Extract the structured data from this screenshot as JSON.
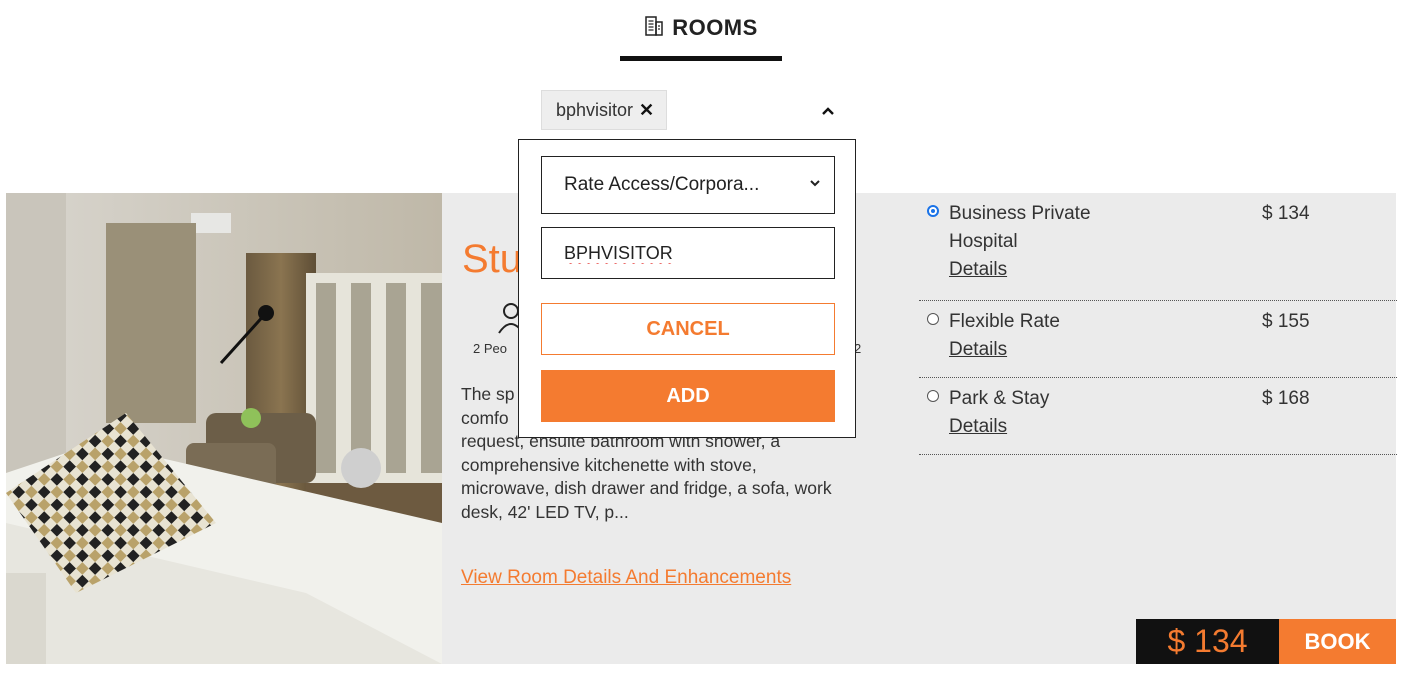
{
  "header": {
    "title": "ROOMS",
    "icon": "building-icon"
  },
  "promo": {
    "chip_label": "bphvisitor",
    "remove_glyph": "✕"
  },
  "popup": {
    "select_value": "Rate Access/Corpora...",
    "input_value": "BPHVISITOR",
    "cancel_label": "CANCEL",
    "add_label": "ADD"
  },
  "room": {
    "title_visible": "Stu",
    "people_visible": "2 Peo",
    "size_visible": "2",
    "description": "The sp comfo request, ensuite bathroom with shower, a comprehensive kitchenette with stove, microwave, dish drawer and fridge, a sofa, work desk, 42' LED TV, p...",
    "description_lines": [
      "The sp",
      "comfo",
      "request, ensuite bathroom with shower, a",
      "comprehensive kitchenette with stove,",
      "microwave, dish drawer and fridge, a sofa, work",
      "desk, 42' LED TV, p..."
    ],
    "view_link": "View Room Details And Enhancements"
  },
  "rates": [
    {
      "name": "Business Private Hospital",
      "price": "$ 134",
      "details": "Details",
      "selected": true
    },
    {
      "name": "Flexible Rate",
      "price": "$ 155",
      "details": "Details",
      "selected": false
    },
    {
      "name": "Park & Stay",
      "price": "$ 168",
      "details": "Details",
      "selected": false
    }
  ],
  "booking": {
    "price": "$ 134",
    "book_label": "BOOK"
  },
  "colors": {
    "accent": "#f47b30",
    "dark": "#111111",
    "card_bg": "#ebebeb",
    "radio_selected": "#1a73e8"
  }
}
